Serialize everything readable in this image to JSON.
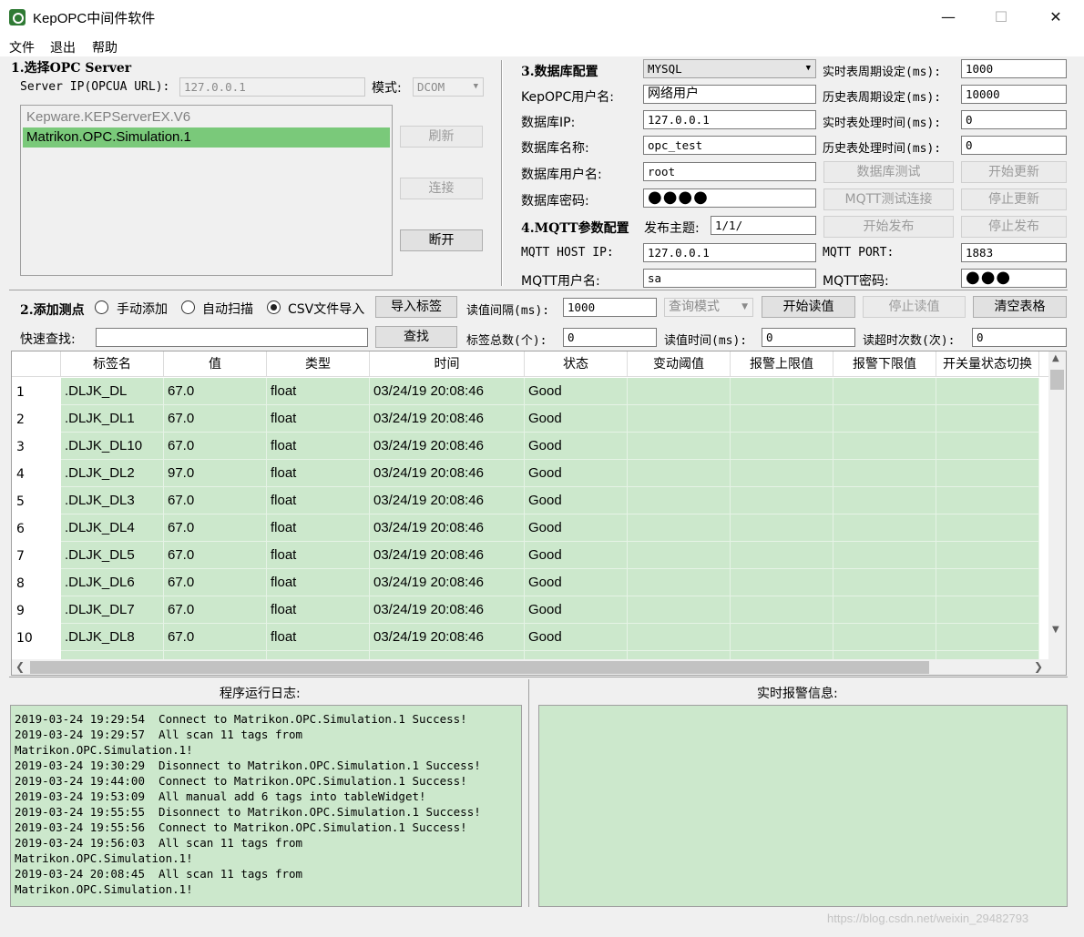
{
  "window": {
    "title": "KepOPC中间件软件",
    "minimize": "—",
    "maximize": "☐",
    "close": "✕"
  },
  "menu": [
    "文件",
    "退出",
    "帮助"
  ],
  "opc": {
    "title": "1.选择OPC Server",
    "server_ip_label": "Server IP(OPCUA URL):",
    "server_ip_value": "127.0.0.1",
    "mode_label": "模式:",
    "mode_value": "DCOM",
    "servers": [
      "Kepware.KEPServerEX.V6",
      "Matrikon.OPC.Simulation.1"
    ],
    "selected_index": 1,
    "refresh": "刷新",
    "connect": "连接",
    "disconnect": "断开"
  },
  "db": {
    "title": "3.数据库配置",
    "db_type": "MYSQL",
    "user_label": "KepOPC用户名:",
    "user_value": "网络用户",
    "ip_label": "数据库IP:",
    "ip_value": "127.0.0.1",
    "name_label": "数据库名称:",
    "name_value": "opc_test",
    "dbuser_label": "数据库用户名:",
    "dbuser_value": "root",
    "pwd_label": "数据库密码:",
    "pwd_value": "●●●●",
    "rt_period_label": "实时表周期设定(ms):",
    "rt_period_value": "1000",
    "hist_period_label": "历史表周期设定(ms):",
    "hist_period_value": "10000",
    "rt_proc_label": "实时表处理时间(ms):",
    "rt_proc_value": "0",
    "hist_proc_label": "历史表处理时间(ms):",
    "hist_proc_value": "0",
    "test_btn": "数据库测试",
    "start_update": "开始更新",
    "mqtt_test": "MQTT测试连接",
    "stop_update": "停止更新"
  },
  "mqtt": {
    "title": "4.MQTT参数配置",
    "topic_label": "发布主题:",
    "topic_value": "1/1/",
    "start_pub": "开始发布",
    "stop_pub": "停止发布",
    "host_label": "MQTT HOST IP:",
    "host_value": "127.0.0.1",
    "port_label": "MQTT PORT:",
    "port_value": "1883",
    "user_label": "MQTT用户名:",
    "user_value": "sa",
    "pwd_label": "MQTT密码:",
    "pwd_value": "●●●"
  },
  "tags": {
    "title": "2.添加测点",
    "manual": "手动添加",
    "auto": "自动扫描",
    "csv": "CSV文件导入",
    "import_btn": "导入标签",
    "interval_label": "读值间隔(ms):",
    "interval_value": "1000",
    "query_mode": "查询模式",
    "start_read": "开始读值",
    "stop_read": "停止读值",
    "clear_table": "清空表格",
    "search_label": "快速查找:",
    "search_value": "",
    "search_btn": "查找",
    "total_label": "标签总数(个):",
    "total_value": "0",
    "read_time_label": "读值时间(ms):",
    "read_time_value": "0",
    "timeout_label": "读超时次数(次):",
    "timeout_value": "0"
  },
  "table": {
    "headers": [
      "标签名",
      "值",
      "类型",
      "时间",
      "状态",
      "变动阈值",
      "报警上限值",
      "报警下限值",
      "开关量状态切换"
    ],
    "rows": [
      [
        "1",
        ".DLJK_DL",
        "67.0",
        "float",
        "03/24/19 20:08:46",
        "Good"
      ],
      [
        "2",
        ".DLJK_DL1",
        "67.0",
        "float",
        "03/24/19 20:08:46",
        "Good"
      ],
      [
        "3",
        ".DLJK_DL10",
        "67.0",
        "float",
        "03/24/19 20:08:46",
        "Good"
      ],
      [
        "4",
        ".DLJK_DL2",
        "97.0",
        "float",
        "03/24/19 20:08:46",
        "Good"
      ],
      [
        "5",
        ".DLJK_DL3",
        "67.0",
        "float",
        "03/24/19 20:08:46",
        "Good"
      ],
      [
        "6",
        ".DLJK_DL4",
        "67.0",
        "float",
        "03/24/19 20:08:46",
        "Good"
      ],
      [
        "7",
        ".DLJK_DL5",
        "67.0",
        "float",
        "03/24/19 20:08:46",
        "Good"
      ],
      [
        "8",
        ".DLJK_DL6",
        "67.0",
        "float",
        "03/24/19 20:08:46",
        "Good"
      ],
      [
        "9",
        ".DLJK_DL7",
        "67.0",
        "float",
        "03/24/19 20:08:46",
        "Good"
      ],
      [
        "10",
        ".DLJK_DL8",
        "67.0",
        "float",
        "03/24/19 20:08:46",
        "Good"
      ]
    ]
  },
  "log": {
    "title": "程序运行日志:",
    "lines": [
      "2019-03-24 19:29:54  Connect to Matrikon.OPC.Simulation.1 Success!",
      "2019-03-24 19:29:57  All scan 11 tags from",
      "Matrikon.OPC.Simulation.1!",
      "2019-03-24 19:30:29  Disonnect to Matrikon.OPC.Simulation.1 Success!",
      "2019-03-24 19:44:00  Connect to Matrikon.OPC.Simulation.1 Success!",
      "2019-03-24 19:53:09  All manual add 6 tags into tableWidget!",
      "2019-03-24 19:55:55  Disonnect to Matrikon.OPC.Simulation.1 Success!",
      "2019-03-24 19:55:56  Connect to Matrikon.OPC.Simulation.1 Success!",
      "2019-03-24 19:56:03  All scan 11 tags from",
      "Matrikon.OPC.Simulation.1!",
      "2019-03-24 20:08:45  All scan 11 tags from",
      "Matrikon.OPC.Simulation.1!"
    ]
  },
  "alarm": {
    "title": "实时报警信息:"
  },
  "watermark": "https://blog.csdn.net/weixin_29482793",
  "colors": {
    "selected_row": "#7ac97a",
    "table_cell": "#cce8cc",
    "log_bg": "#cce8cc"
  }
}
